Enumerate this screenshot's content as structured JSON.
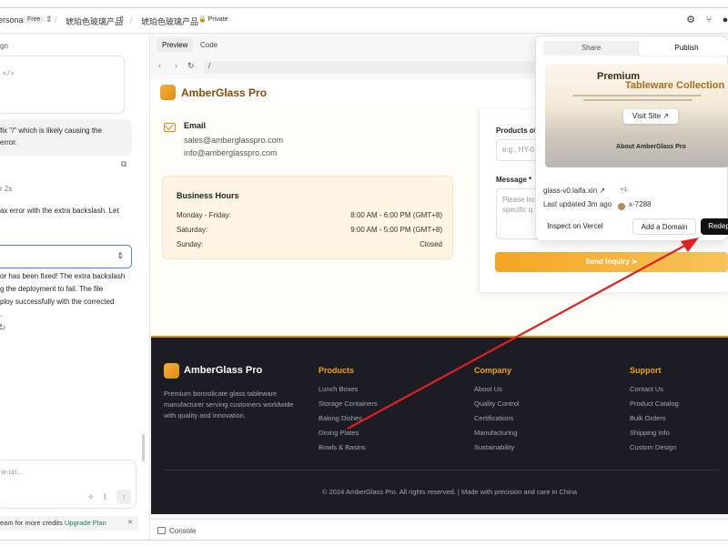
{
  "topbar": {
    "workspace": "ersonal",
    "plan_badge": "Free",
    "project_left": "琥珀色玻璃产品",
    "project_right": "琥珀色玻璃产品",
    "visibility": "🔒 Private",
    "icons": [
      "gear-icon",
      "fork-icon",
      "github-icon"
    ]
  },
  "chat": {
    "line_sign": "gn",
    "code_lines": [
      "</>"
    ],
    "msg1": [
      "fix \"/\" which is likely causing the",
      "error."
    ],
    "timestamp": "r 2s",
    "msg2": [
      "ax error with the extra backslash. Let"
    ],
    "msg3": [
      "or has been fixed! The extra backslash",
      "g the deployment to fail. The file",
      "ploy successfully with the corrected",
      "."
    ],
    "input_placeholder": "w-up...",
    "credits_text": "eam for more credits",
    "upgrade_label": "Upgrade Plan",
    "close_label": "✕"
  },
  "preview": {
    "tabs": [
      {
        "label": "Preview",
        "active": true
      },
      {
        "label": "Code",
        "active": false
      }
    ],
    "url": "/",
    "console_label": "Console"
  },
  "site": {
    "brand": "AmberGlass Pro",
    "email": {
      "heading": "Email",
      "lines": [
        "sales@amberglasspro.com",
        "info@amberglasspro.com"
      ]
    },
    "hours": {
      "title": "Business Hours",
      "rows": [
        {
          "day": "Monday - Friday:",
          "time": "8:00 AM - 6:00 PM (GMT+8)"
        },
        {
          "day": "Saturday:",
          "time": "9:00 AM - 5:00 PM (GMT+8)"
        },
        {
          "day": "Sunday:",
          "time": "Closed"
        }
      ]
    },
    "form": {
      "products_label": "Products of",
      "products_placeholder": "e.g., HY-0",
      "message_label": "Message *",
      "message_placeholder": [
        "Please inc",
        "specific q"
      ],
      "send_label": "Send Inquiry ➤"
    },
    "footer": {
      "brand": "AmberGlass Pro",
      "description": "Premium borosilicate glass tableware manufacturer serving customers worldwide with quality and innovation.",
      "columns": [
        {
          "title": "Products",
          "links": [
            "Lunch Boxes",
            "Storage Containers",
            "Baking Dishes",
            "Dining Plates",
            "Bowls & Basins"
          ]
        },
        {
          "title": "Company",
          "links": [
            "About Us",
            "Quality Control",
            "Certifications",
            "Manufacturing",
            "Sustainability"
          ]
        },
        {
          "title": "Support",
          "links": [
            "Contact Us",
            "Product Catalog",
            "Bulk Orders",
            "Shipping Info",
            "Custom Design"
          ]
        }
      ],
      "copyright": "© 2024 AmberGlass Pro. All rights reserved. | Made with precision and care in China"
    }
  },
  "publish": {
    "tabs": [
      {
        "label": "Share",
        "active": false
      },
      {
        "label": "Publish",
        "active": true
      }
    ],
    "thumb_title_1": "Premium",
    "thumb_title_2": "Tableware Collection",
    "visit_label": "Visit Site ↗",
    "thumb_about": "About AmberGlass Pro",
    "domain": "glass-v0.laifa.xin ↗",
    "plus_count": "+1",
    "updated": "Last updated 3m ago",
    "user": "x-7288",
    "inspect_label": "Inspect on Vercel",
    "add_domain_label": "Add a Domain",
    "redeploy_label": "Redep"
  },
  "annotation": {
    "arrow_color": "#e02020"
  }
}
